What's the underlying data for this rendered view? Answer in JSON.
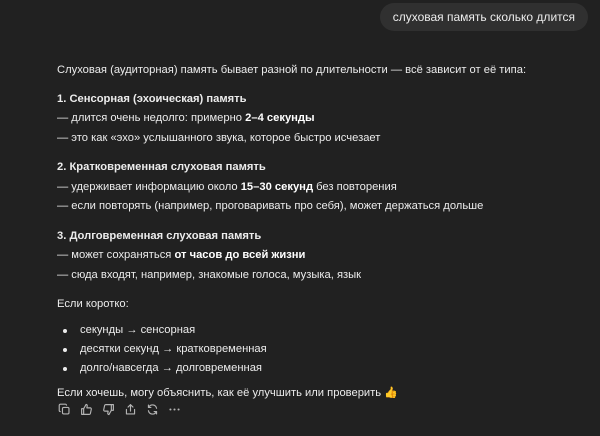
{
  "user_message": "слуховая память сколько длится",
  "answer": {
    "intro": "Слуховая (аудиторная) память бывает разной по длительности — всё зависит от её типа:",
    "sections": [
      {
        "title": "1. Сенсорная (эхоическая) память",
        "lines": [
          {
            "pre": "— длится очень недолго: примерно ",
            "bold": "2–4 секунды",
            "post": ""
          },
          {
            "pre": "— это как «эхо» услышанного звука, которое быстро исчезает",
            "bold": "",
            "post": ""
          }
        ]
      },
      {
        "title": "2. Кратковременная слуховая память",
        "lines": [
          {
            "pre": "— удерживает информацию около ",
            "bold": "15–30 секунд",
            "post": " без повторения"
          },
          {
            "pre": "— если повторять (например, проговаривать про себя), может держаться дольше",
            "bold": "",
            "post": ""
          }
        ]
      },
      {
        "title": "3. Долговременная слуховая память",
        "lines": [
          {
            "pre": "— может сохраняться ",
            "bold": "от часов до всей жизни",
            "post": ""
          },
          {
            "pre": "— сюда входят, например, знакомые голоса, музыка, язык",
            "bold": "",
            "post": ""
          }
        ]
      }
    ],
    "summary_label": "Если коротко:",
    "bullets": [
      "секунды → сенсорная",
      "десятки секунд → кратковременная",
      "долго/навсегда → долговременная"
    ],
    "closing": "Если хочешь, могу объяснить, как её улучшить или проверить",
    "closing_emoji": "👍"
  },
  "actions": [
    {
      "name": "copy-icon"
    },
    {
      "name": "thumbs-up-icon"
    },
    {
      "name": "thumbs-down-icon"
    },
    {
      "name": "share-icon"
    },
    {
      "name": "regenerate-icon"
    },
    {
      "name": "more-icon"
    }
  ]
}
